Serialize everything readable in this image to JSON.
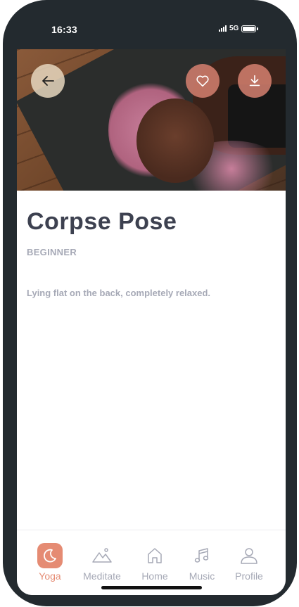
{
  "status_bar": {
    "time": "16:33",
    "network": "5G"
  },
  "pose": {
    "title": "Corpse Pose",
    "level": "BEGINNER",
    "description": "Lying flat on the back, completely relaxed."
  },
  "tabs": [
    {
      "label": "Yoga",
      "icon": "moon-icon",
      "active": true
    },
    {
      "label": "Meditate",
      "icon": "mountain-icon",
      "active": false
    },
    {
      "label": "Home",
      "icon": "home-icon",
      "active": false
    },
    {
      "label": "Music",
      "icon": "music-note-icon",
      "active": false
    },
    {
      "label": "Profile",
      "icon": "user-icon",
      "active": false
    }
  ],
  "colors": {
    "accent": "#e58b73",
    "title": "#3d4150",
    "muted": "#a6a9b6",
    "frame": "#232a2f"
  }
}
